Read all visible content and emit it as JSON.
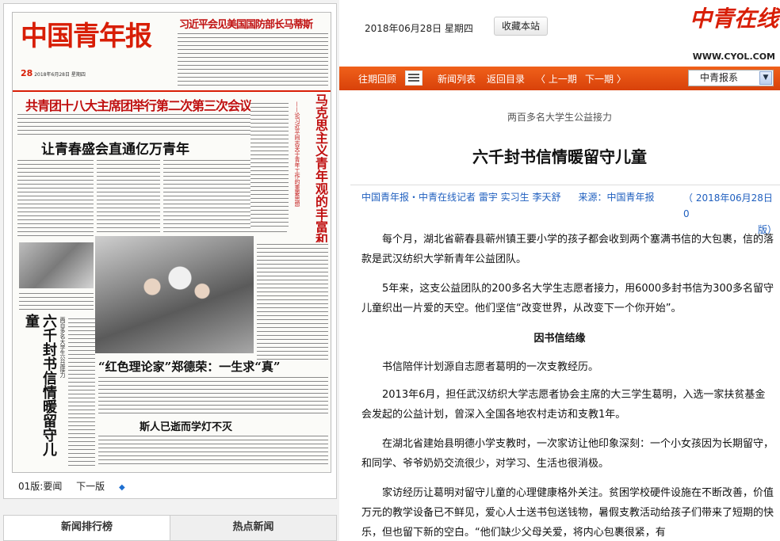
{
  "paper": {
    "masthead_logo": "中国青年报",
    "issue_date": "2018年6月28日 星期四",
    "issue_day": "28",
    "top_headline": "习近平会见美国国防部长马蒂斯",
    "lead_headline": "共青团十八大主席团举行第二次第三次会议",
    "second_headline": "让青春盛会直通亿万青年",
    "vertical_headline": "马克思主义青年观的丰富和发展",
    "vertical_subhead": "——论习近平同志关于青年工作的重要思想",
    "left_vertical_headline": "六千封书信情暖留守儿童",
    "left_vertical_subhead": "两百多名大学生公益接力",
    "feature_headline": "“红色理论家”郑德荣：一生求“真”",
    "bottom_headline": "斯人已逝而学灯不灭",
    "page_label": "01版:要闻",
    "next_page": "下一版"
  },
  "tabs": {
    "rank": "新闻排行榜",
    "hot": "热点新闻"
  },
  "site": {
    "date": "2018年06月28日 星期四",
    "favorite": "收藏本站",
    "logo": "中青在线",
    "url": "WWW.CYOL.COM"
  },
  "nav": {
    "past": "往期回顾",
    "list": "新闻列表",
    "back": "返回目录",
    "prev": "上一期",
    "next": "下一期",
    "select_value": "中青报系"
  },
  "article": {
    "kicker": "两百多名大学生公益接力",
    "title": "六千封书信情暖留守儿童",
    "byline": "中国青年报・中青在线记者 雷宇 实习生 李天舒",
    "source": "来源：中国青年报",
    "pubdate": "（ 2018年06月28日　0",
    "pubdate_tail": "版）",
    "p1": "每个月，湖北省蕲春县蕲州镇王要小学的孩子都会收到两个塞满书信的大包裹，信的落款是武汉纺织大学新青年公益团队。",
    "p2": "5年来，这支公益团队的200多名大学生志愿者接力，用6000多封书信为300多名留守儿童织出一片爱的天空。他们坚信“改变世界，从改变下一个你开始”。",
    "subhead": "因书信结缘",
    "p3": "书信陪伴计划源自志愿者葛明的一次支教经历。",
    "p4": "2013年6月，担任武汉纺织大学志愿者协会主席的大三学生葛明，入选一家扶贫基金会发起的公益计划，曾深入全国各地农村走访和支教1年。",
    "p5": "在湖北省建始县明德小学支教时，一次家访让他印象深刻：一个小女孩因为长期留守，和同学、爷爷奶奶交流很少，对学习、生活也很消极。",
    "p6": "家访经历让葛明对留守儿童的心理健康格外关注。贫困学校硬件设施在不断改善，价值万元的教学设备已不鲜见，爱心人士送书包送钱物，暑假支教活动给孩子们带来了短期的快乐，但也留下新的空白。“他们缺少父母关爱，将内心包裹很紧，有"
  }
}
